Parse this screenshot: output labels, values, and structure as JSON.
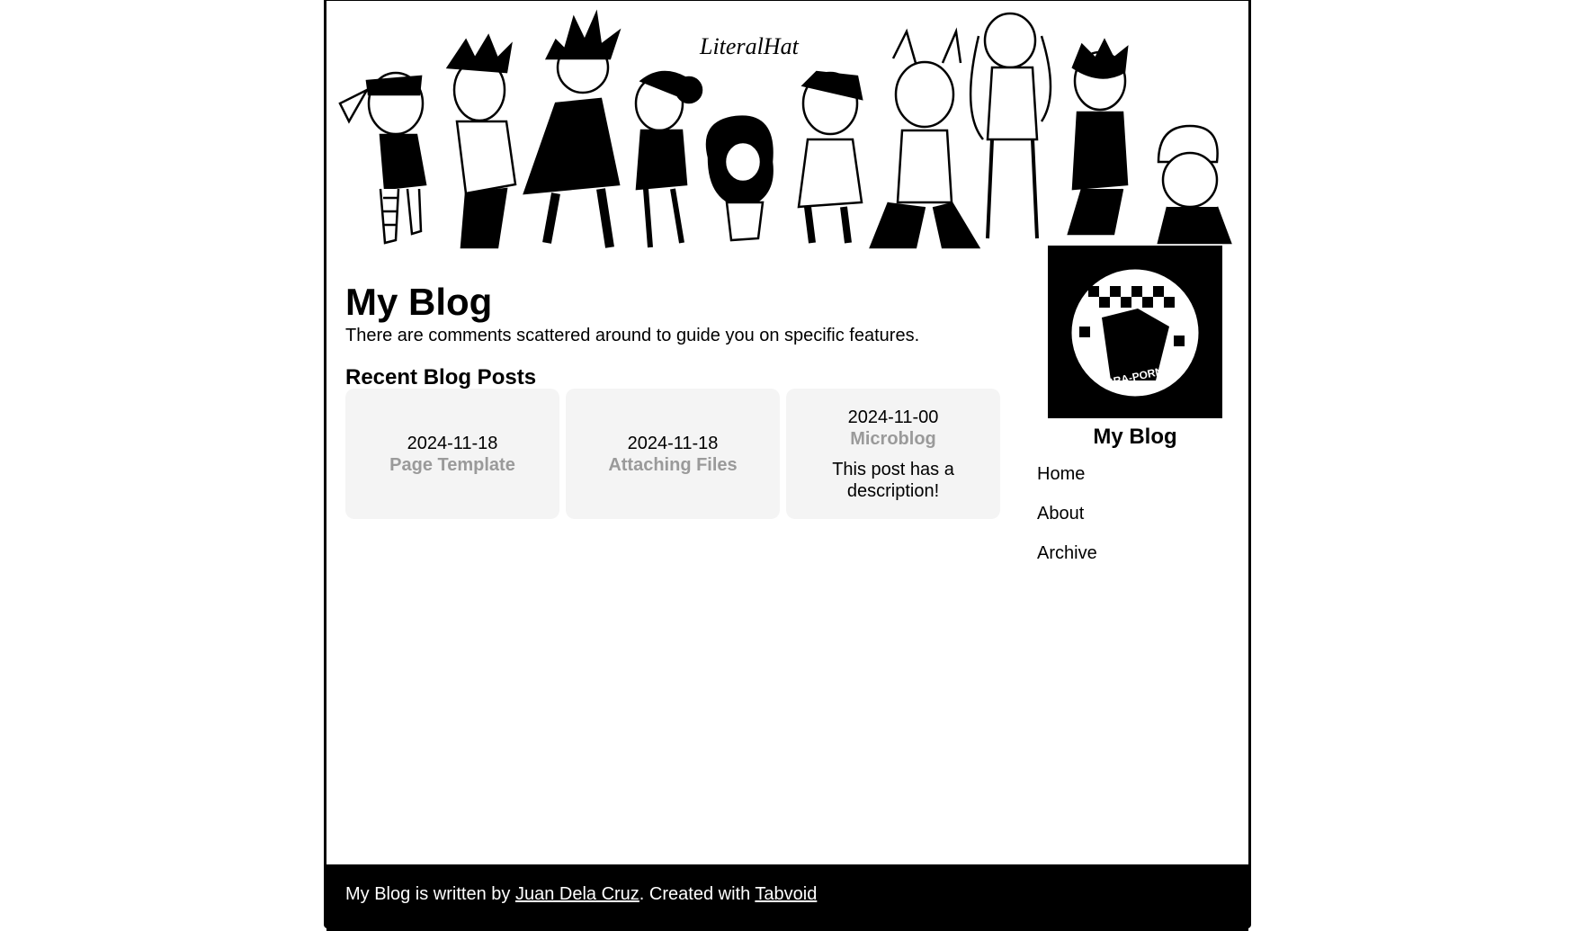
{
  "banner": {
    "signature": "LiteralHat"
  },
  "blog": {
    "title": "My Blog",
    "description": "There are comments scattered around to guide you on specific features."
  },
  "recent": {
    "heading": "Recent Blog Posts",
    "posts": [
      {
        "date": "2024-11-18",
        "title": "Page Template",
        "description": ""
      },
      {
        "date": "2024-11-18",
        "title": "Attaching Files",
        "description": ""
      },
      {
        "date": "2024-11-00",
        "title": "Microblog",
        "description": "This post has a description!"
      }
    ]
  },
  "sidebar": {
    "title": "My Blog",
    "badge_text": "BRA-PORN",
    "nav": [
      {
        "label": "Home"
      },
      {
        "label": "About"
      },
      {
        "label": "Archive"
      }
    ]
  },
  "footer": {
    "prefix": "My Blog is written by ",
    "author": "Juan Dela Cruz",
    "middle": ". Created with ",
    "tool": "Tabvoid"
  },
  "colors": {
    "card_bg": "#f4f4f4",
    "post_title": "#9a9a9a",
    "footer_bg": "#000000"
  }
}
